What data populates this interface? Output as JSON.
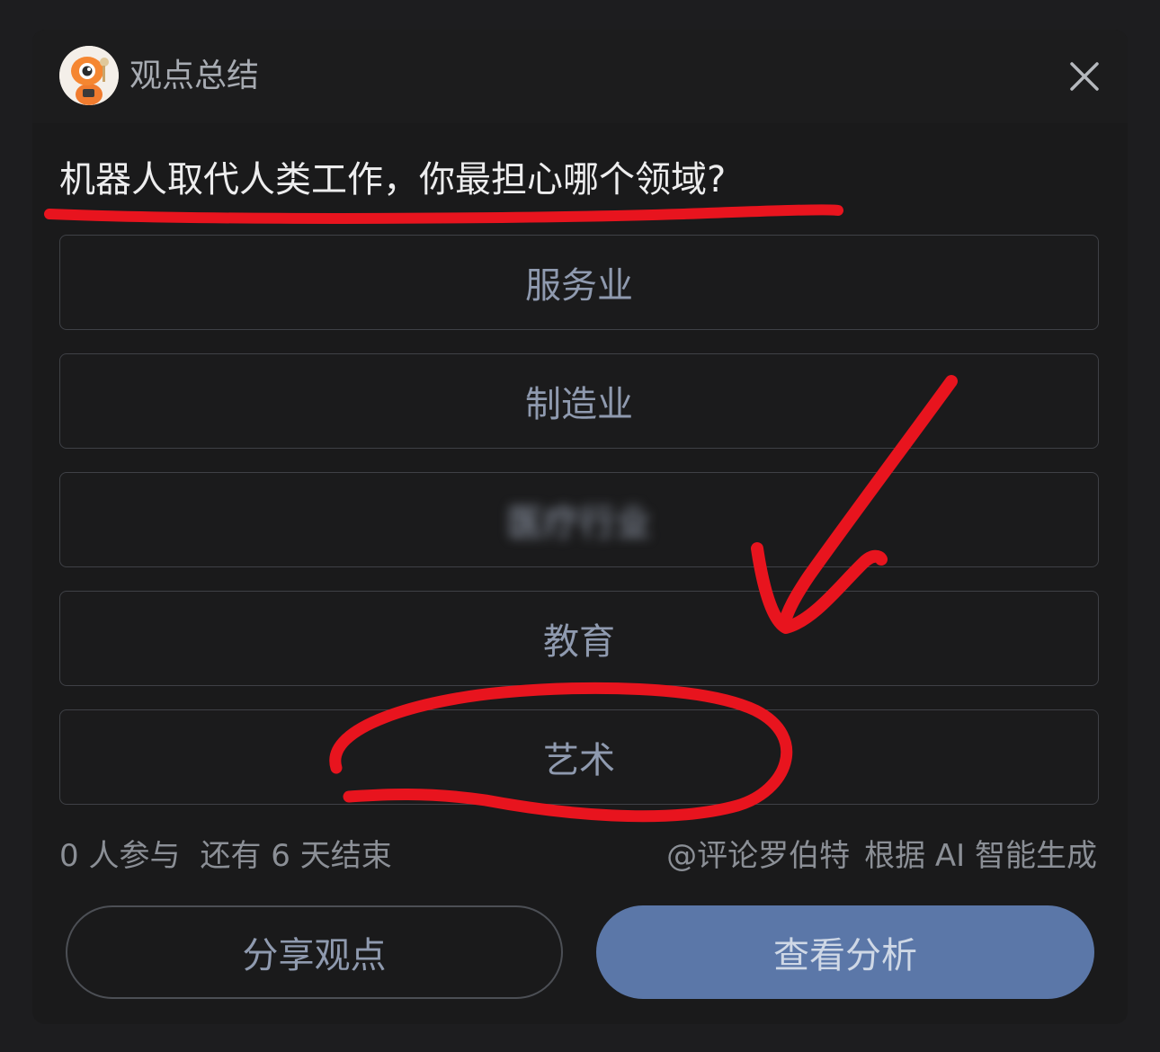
{
  "header": {
    "title": "观点总结",
    "avatar_icon": "robot-mascot-avatar",
    "close_icon": "close-icon"
  },
  "poll": {
    "question": "机器人取代人类工作，你最担心哪个领域?",
    "options": [
      {
        "label": "服务业"
      },
      {
        "label": "制造业"
      },
      {
        "label": "医疗行业",
        "blurred": true
      },
      {
        "label": "教育"
      },
      {
        "label": "艺术"
      }
    ],
    "participants": "0 人参与",
    "remaining": "还有 6 天结束",
    "source": "@评论罗伯特",
    "generated_by": "根据 AI 智能生成"
  },
  "actions": {
    "share_label": "分享观点",
    "analysis_label": "查看分析"
  },
  "colors": {
    "card_bg": "#1a1a1b",
    "accent_button": "#5b77a8",
    "annotation_red": "#e8141e"
  }
}
